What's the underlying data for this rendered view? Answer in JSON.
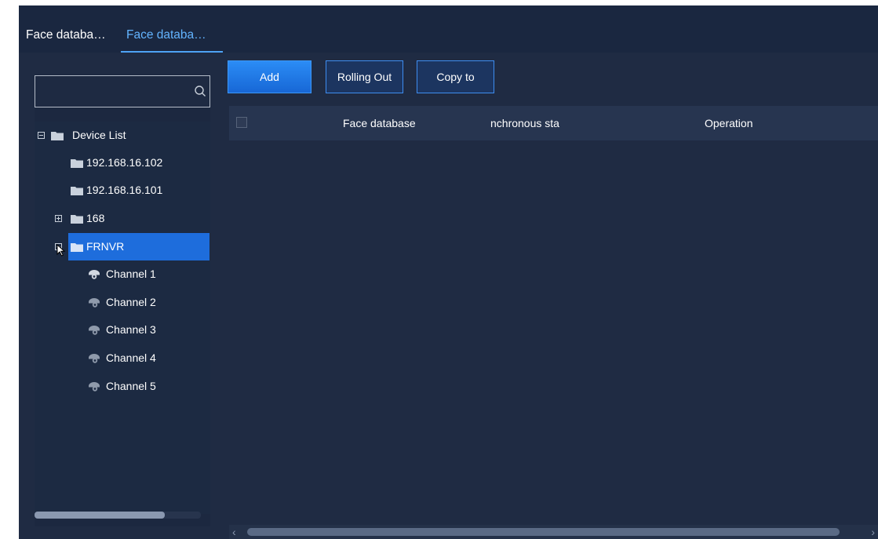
{
  "tabs": [
    {
      "label": "Face databa…",
      "active": false
    },
    {
      "label": "Face databa…",
      "active": true
    }
  ],
  "search": {
    "placeholder": "",
    "value": ""
  },
  "tree": {
    "root": "Device List",
    "items": [
      {
        "label": "192.168.16.102",
        "icon": "folder-icon"
      },
      {
        "label": "192.168.16.101",
        "icon": "folder-icon"
      },
      {
        "label": "168",
        "icon": "folder-icon",
        "expand": "plus"
      },
      {
        "label": "FRNVR",
        "icon": "folder-icon",
        "expand": "minus",
        "selected": true
      },
      {
        "label": "Channel 1",
        "icon": "camera-online-icon"
      },
      {
        "label": "Channel 2",
        "icon": "camera-offline-icon"
      },
      {
        "label": "Channel 3",
        "icon": "camera-offline-icon"
      },
      {
        "label": "Channel 4",
        "icon": "camera-offline-icon"
      },
      {
        "label": "Channel 5",
        "icon": "camera-offline-icon"
      }
    ]
  },
  "toolbar": {
    "add_label": "Add",
    "rolling_out_label": "Rolling Out",
    "copy_to_label": "Copy to"
  },
  "table": {
    "columns": [
      "Face database",
      "nchronous sta",
      "Operation"
    ],
    "rows": []
  },
  "colors": {
    "accent": "#1e6ddc",
    "active_tab": "#63b4ff",
    "background": "#1f2b43"
  }
}
